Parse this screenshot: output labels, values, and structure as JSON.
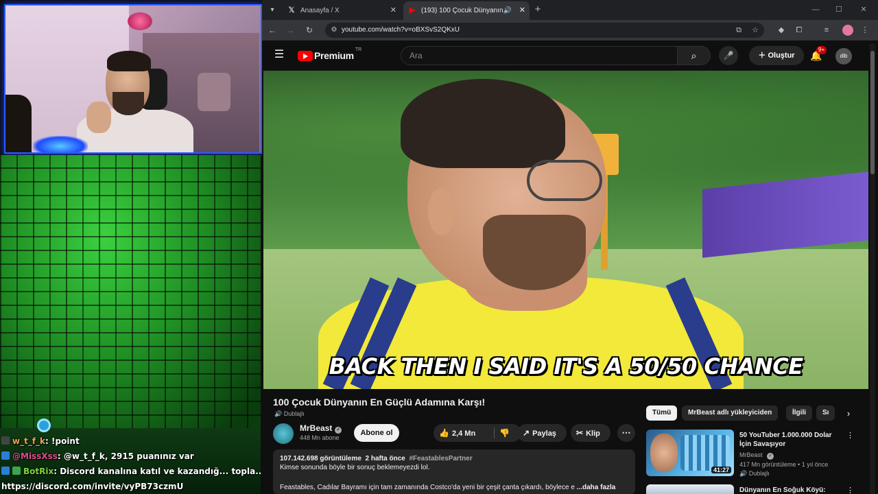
{
  "stream": {
    "chat": [
      {
        "user": "w_t_f_k",
        "message": ": !point"
      },
      {
        "user": "@MissXss",
        "message": ": @w_t_f_k, 2915 puanınız var"
      },
      {
        "user": "BotRix",
        "message": ": Discord kanalına katıl ve kazandığ... topla...!"
      }
    ],
    "chat_link": "https://discord.com/invite/vyPB73czmU"
  },
  "browser": {
    "tabs": [
      {
        "icon": "x-logo-icon",
        "title": "Anasayfa / X"
      },
      {
        "icon": "youtube-icon",
        "title": "(193) 100 Çocuk Dünyanın"
      }
    ],
    "url": "youtube.com/watch?v=oBXSvS2QKxU"
  },
  "youtube": {
    "logo_text": "Premium",
    "logo_region": "TR",
    "search_placeholder": "Ara",
    "create_label": "Oluştur",
    "notifications": "9+",
    "avatar_text": "dib",
    "caption": "BACK THEN I SAID IT'S A 50/50 CHANCE",
    "title": "100 Çocuk Dünyanın En Güçlü Adamına Karşı!",
    "dubbed_label": "Dublajlı",
    "channel": "MrBeast",
    "subscribers": "448 Mn abone",
    "subscribe_label": "Abone ol",
    "likes": "2,4 Mn",
    "share_label": "Paylaş",
    "clip_label": "Klip",
    "description": {
      "views": "107.142.698 görüntüleme",
      "age": "2 hafta önce",
      "hashtag": "#FeastablesPartner",
      "line1": "Kimse sonunda böyle bir sonuç beklemeyezdi lol.",
      "line3": "Feastables, Cadılar Bayramı için tam zamanında Costco'da yeni bir çeşit çanta çıkardı, böylece e",
      "more": "...daha fazla"
    },
    "chips": [
      "Tümü",
      "MrBeast adlı yükleyiciden",
      "İlgili",
      "Sı"
    ],
    "recommendations": [
      {
        "title": "50 YouTuber 1.000.000 Dolar İçin Savaşıyor",
        "channel": "MrBeast",
        "meta": "417 Mn görüntüleme • 1 yıl önce",
        "dubbed": "Dublajlı",
        "duration": "41:27"
      },
      {
        "title": "Dünyanın En Soğuk Köyü:",
        "channel": "",
        "meta": "",
        "dubbed": "",
        "duration": ""
      }
    ]
  }
}
